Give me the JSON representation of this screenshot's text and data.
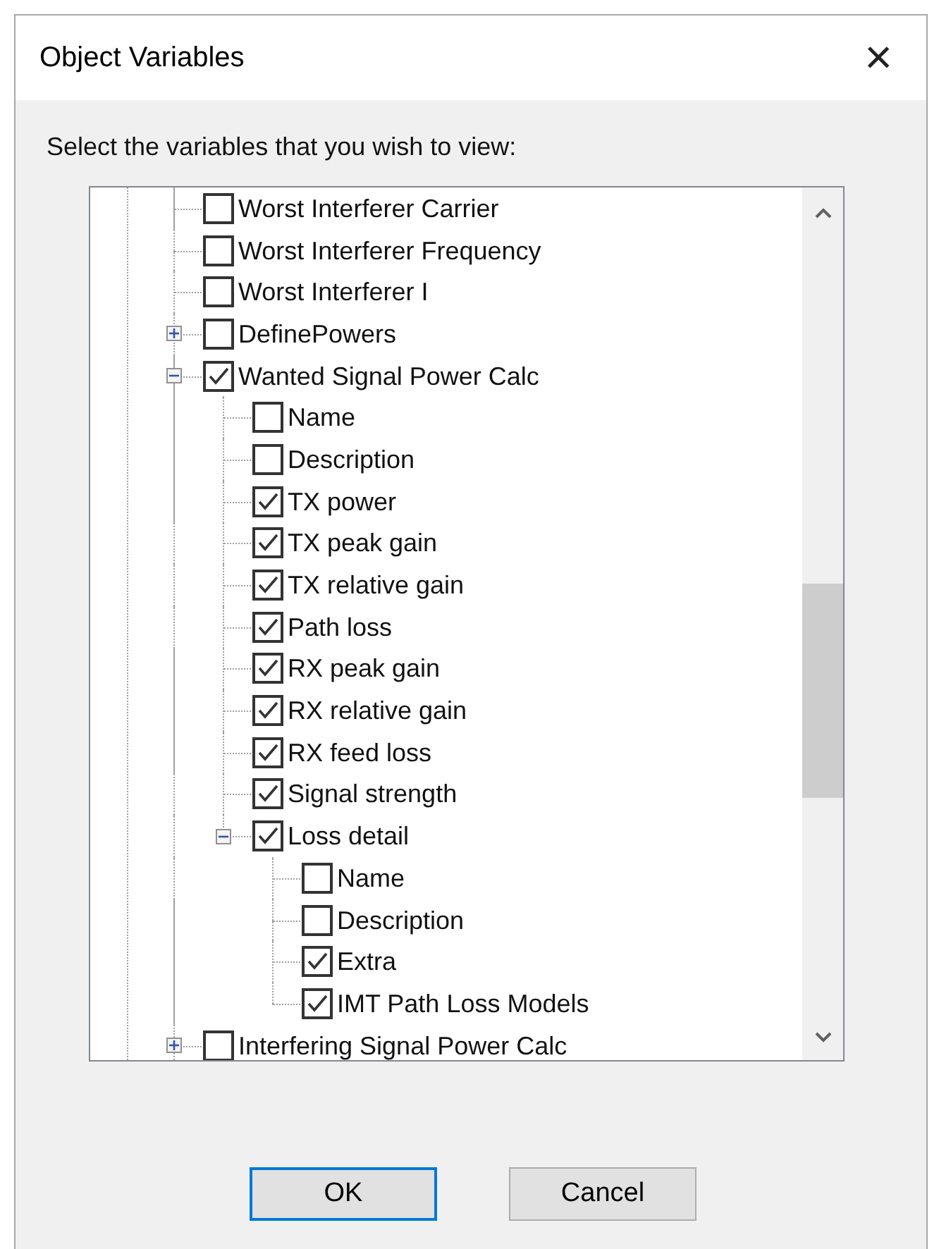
{
  "window": {
    "title": "Object Variables",
    "close": "×"
  },
  "prompt": "Select the variables that you wish to view:",
  "tree": {
    "items": [
      {
        "label": "Worst Interferer Carrier",
        "checked": false
      },
      {
        "label": "Worst Interferer Frequency",
        "checked": false
      },
      {
        "label": "Worst Interferer I",
        "checked": false
      },
      {
        "label": "DefinePowers",
        "checked": false,
        "expanded": false
      },
      {
        "label": "Wanted Signal Power Calc",
        "checked": true,
        "expanded": true,
        "children": [
          {
            "label": "Name",
            "checked": false
          },
          {
            "label": "Description",
            "checked": false
          },
          {
            "label": "TX power",
            "checked": true
          },
          {
            "label": "TX peak gain",
            "checked": true
          },
          {
            "label": "TX relative gain",
            "checked": true
          },
          {
            "label": "Path loss",
            "checked": true
          },
          {
            "label": "RX peak gain",
            "checked": true
          },
          {
            "label": "RX relative gain",
            "checked": true
          },
          {
            "label": "RX feed loss",
            "checked": true
          },
          {
            "label": "Signal strength",
            "checked": true
          },
          {
            "label": "Loss detail",
            "checked": true,
            "expanded": true,
            "children": [
              {
                "label": "Name",
                "checked": false
              },
              {
                "label": "Description",
                "checked": false
              },
              {
                "label": "Extra",
                "checked": true
              },
              {
                "label": "IMT Path Loss Models",
                "checked": true
              }
            ]
          }
        ]
      },
      {
        "label": "Interfering Signal Power Calc",
        "checked": false,
        "expanded": false
      }
    ]
  },
  "buttons": [
    {
      "label": "OK",
      "default": true
    },
    {
      "label": "Cancel",
      "default": false
    }
  ]
}
